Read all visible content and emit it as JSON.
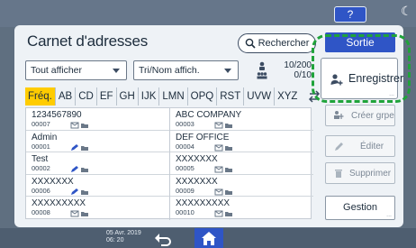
{
  "header": {
    "help_label": "?"
  },
  "panel": {
    "title": "Carnet d'adresses",
    "search_label": "Rechercher",
    "filter_select": "Tout afficher",
    "sort_select": "Tri/Nom affich.",
    "count": {
      "current": "10/200",
      "total": "0/10"
    }
  },
  "tabs": [
    "Fréq.",
    "AB",
    "CD",
    "EF",
    "GH",
    "IJK",
    "LMN",
    "OPQ",
    "RST",
    "UVW",
    "XYZ"
  ],
  "entries": [
    {
      "name": "1234567890",
      "number": "00007"
    },
    {
      "name": "ABC COMPANY",
      "number": "00003"
    },
    {
      "name": "Admin",
      "number": "00001"
    },
    {
      "name": "DEF OFFICE",
      "number": "00004"
    },
    {
      "name": "Test",
      "number": "00002"
    },
    {
      "name": "XXXXXXX",
      "number": "00005"
    },
    {
      "name": "XXXXXXX",
      "number": "00006"
    },
    {
      "name": "XXXXXXX",
      "number": "00009"
    },
    {
      "name": "XXXXXXXXX",
      "number": "00008"
    },
    {
      "name": "XXXXXXXXX",
      "number": "00010"
    }
  ],
  "side": {
    "sortie": "Sortie",
    "enregistrer": "Enregistrer",
    "creer_grpe": "Créer grpe",
    "editer": "Éditer",
    "supprimer": "Supprimer",
    "gestion": "Gestion",
    "dots": "..."
  },
  "footer": {
    "date": "05 Avr. 2019",
    "time": "06: 20"
  },
  "colors": {
    "accent_blue": "#2f55c6",
    "active_tab": "#ffcc00",
    "highlight": "#1fa33a"
  },
  "icons": [
    "moon-icon",
    "search-icon",
    "users-icon",
    "sort-icon",
    "user-add-icon",
    "group-add-icon",
    "pencil-icon",
    "trash-icon",
    "back-arrow-icon",
    "home-icon"
  ]
}
